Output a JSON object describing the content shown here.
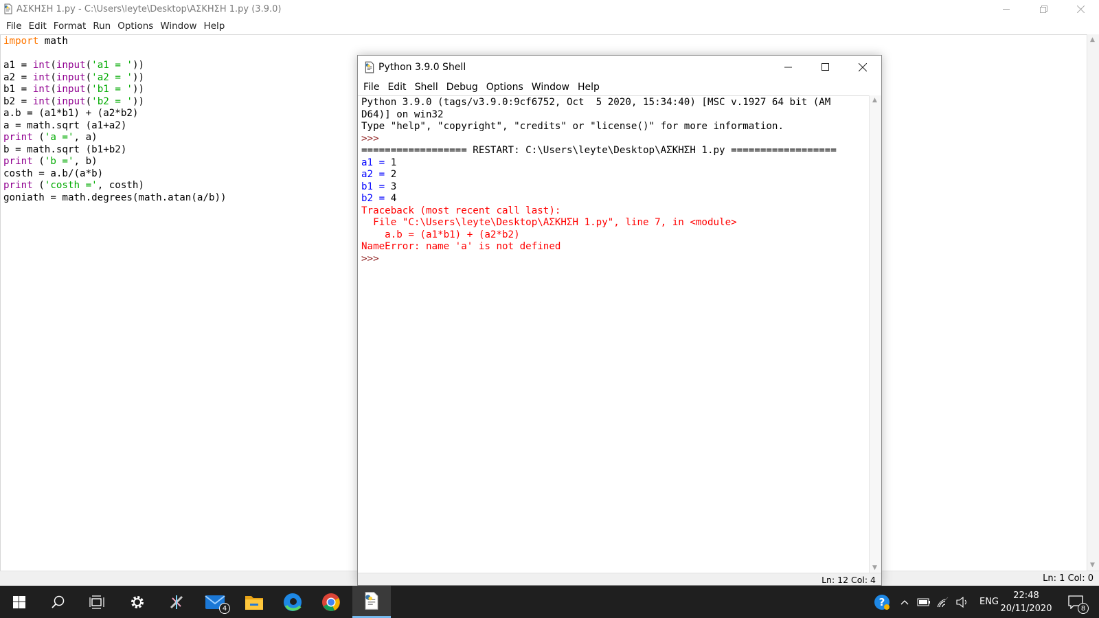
{
  "editor": {
    "title": "ΑΣΚΗΣΗ 1.py - C:\\Users\\leyte\\Desktop\\ΑΣΚΗΣΗ 1.py (3.9.0)",
    "menu": [
      "File",
      "Edit",
      "Format",
      "Run",
      "Options",
      "Window",
      "Help"
    ],
    "status": "Ln: 1  Col: 0",
    "code_lines": [
      [
        [
          "kw",
          "import"
        ],
        [
          "",
          " math"
        ]
      ],
      [],
      [
        [
          "",
          "a1 = "
        ],
        [
          "bi",
          "int"
        ],
        [
          "",
          "("
        ],
        [
          "bi",
          "input"
        ],
        [
          "",
          "("
        ],
        [
          "st",
          "'a1 = '"
        ],
        [
          "",
          "))"
        ]
      ],
      [
        [
          "",
          "a2 = "
        ],
        [
          "bi",
          "int"
        ],
        [
          "",
          "("
        ],
        [
          "bi",
          "input"
        ],
        [
          "",
          "("
        ],
        [
          "st",
          "'a2 = '"
        ],
        [
          "",
          "))"
        ]
      ],
      [
        [
          "",
          "b1 = "
        ],
        [
          "bi",
          "int"
        ],
        [
          "",
          "("
        ],
        [
          "bi",
          "input"
        ],
        [
          "",
          "("
        ],
        [
          "st",
          "'b1 = '"
        ],
        [
          "",
          "))"
        ]
      ],
      [
        [
          "",
          "b2 = "
        ],
        [
          "bi",
          "int"
        ],
        [
          "",
          "("
        ],
        [
          "bi",
          "input"
        ],
        [
          "",
          "("
        ],
        [
          "st",
          "'b2 = '"
        ],
        [
          "",
          "))"
        ]
      ],
      [
        [
          "",
          "a.b = (a1*b1) + (a2*b2)"
        ]
      ],
      [
        [
          "",
          "a = math.sqrt (a1+a2)"
        ]
      ],
      [
        [
          "bi",
          "print"
        ],
        [
          "",
          " ("
        ],
        [
          "st",
          "'a ='"
        ],
        [
          "",
          ", a)"
        ]
      ],
      [
        [
          "",
          "b = math.sqrt (b1+b2)"
        ]
      ],
      [
        [
          "bi",
          "print"
        ],
        [
          "",
          " ("
        ],
        [
          "st",
          "'b ='"
        ],
        [
          "",
          ", b)"
        ]
      ],
      [
        [
          "",
          "costh = a.b/(a*b)"
        ]
      ],
      [
        [
          "bi",
          "print"
        ],
        [
          "",
          " ("
        ],
        [
          "st",
          "'costh ='"
        ],
        [
          "",
          ", costh)"
        ]
      ],
      [
        [
          "",
          "goniath = math.degrees(math.atan(a/b))"
        ]
      ]
    ]
  },
  "shell": {
    "title": "Python 3.9.0 Shell",
    "menu": [
      "File",
      "Edit",
      "Shell",
      "Debug",
      "Options",
      "Window",
      "Help"
    ],
    "status": "Ln: 12  Col: 4",
    "output_lines": [
      [
        [
          "",
          "Python 3.9.0 (tags/v3.9.0:9cf6752, Oct  5 2020, 15:34:40) [MSC v.1927 64 bit (AM"
        ]
      ],
      [
        [
          "",
          "D64)] on win32"
        ]
      ],
      [
        [
          "",
          "Type \"help\", \"copyright\", \"credits\" or \"license()\" for more information."
        ]
      ],
      [
        [
          "prompt",
          ">>> "
        ]
      ],
      [
        [
          "",
          "================== RESTART: C:\\Users\\leyte\\Desktop\\ΑΣΚΗΣΗ 1.py =================="
        ]
      ],
      [
        [
          "blue",
          "a1 = "
        ],
        [
          "",
          "1"
        ]
      ],
      [
        [
          "blue",
          "a2 = "
        ],
        [
          "",
          "2"
        ]
      ],
      [
        [
          "blue",
          "b1 = "
        ],
        [
          "",
          "3"
        ]
      ],
      [
        [
          "blue",
          "b2 = "
        ],
        [
          "",
          "4"
        ]
      ],
      [
        [
          "err",
          "Traceback (most recent call last):"
        ]
      ],
      [
        [
          "err",
          "  File \"C:\\Users\\leyte\\Desktop\\ΑΣΚΗΣΗ 1.py\", line 7, in <module>"
        ]
      ],
      [
        [
          "err",
          "    a.b = (a1*b1) + (a2*b2)"
        ]
      ],
      [
        [
          "err",
          "NameError: name 'a' is not defined"
        ]
      ],
      [
        [
          "prompt",
          ">>> "
        ]
      ]
    ]
  },
  "taskbar": {
    "apps": [
      "windows-start",
      "search",
      "task-view",
      "settings",
      "itunes",
      "mail",
      "file-explorer",
      "edge",
      "chrome",
      "idle"
    ],
    "mail_badge": "4",
    "language": "ENG",
    "time": "22:48",
    "date": "20/11/2020",
    "notification_count": "8"
  },
  "colors": {
    "keyword": "#ff7700",
    "builtin": "#900090",
    "string": "#00aa00",
    "stdout": "#0000ff",
    "stderr": "#ff0000",
    "prompt": "#8b1a1a",
    "taskbar": "#1f1f1f",
    "taskbar_active": "#76b9ed"
  }
}
